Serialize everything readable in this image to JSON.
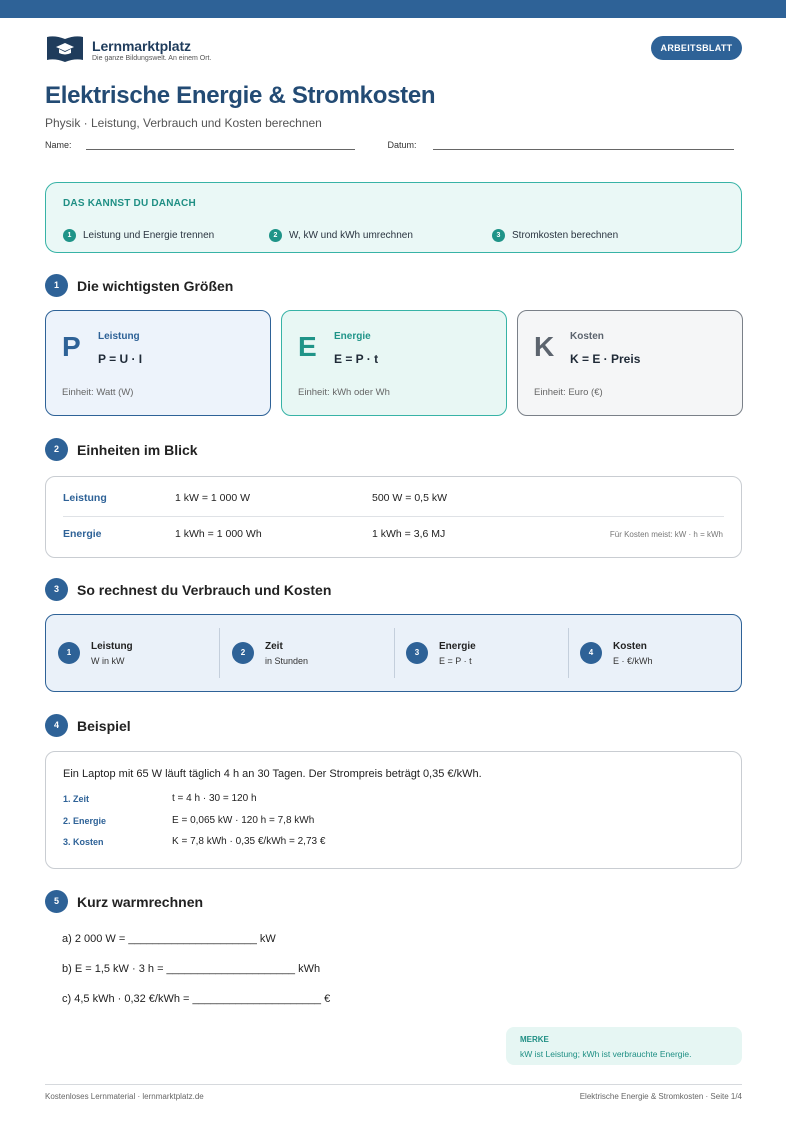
{
  "brand": {
    "name": "Lernmarktplatz",
    "tagline": "Die ganze Bildungswelt. An einem Ort.",
    "badge": "ARBEITSBLATT",
    "color": "#2e6297"
  },
  "header": {
    "title": "Elektrische Energie & Stromkosten",
    "subtitle": "Physik · Leistung, Verbrauch und Kosten berechnen",
    "name_label": "Name:",
    "date_label": "Datum:"
  },
  "goals": {
    "title": "DAS KANNST DU DANACH",
    "items": [
      {
        "num": "1",
        "text": "Leistung und Energie trennen"
      },
      {
        "num": "2",
        "text": "W, kW und kWh umrechnen"
      },
      {
        "num": "3",
        "text": "Stromkosten berechnen"
      }
    ]
  },
  "sections": [
    {
      "num": "1",
      "title": "Die wichtigsten Größen"
    },
    {
      "num": "2",
      "title": "Einheiten im Blick"
    },
    {
      "num": "3",
      "title": "So rechnest du Verbrauch und Kosten"
    },
    {
      "num": "4",
      "title": "Beispiel"
    },
    {
      "num": "5",
      "title": "Kurz warmrechnen"
    }
  ],
  "quantities": [
    {
      "letter": "P",
      "name": "Leistung",
      "formula": "P = U · I",
      "unit": "Einheit: Watt (W)"
    },
    {
      "letter": "E",
      "name": "Energie",
      "formula": "E = P · t",
      "unit": "Einheit: kWh oder Wh"
    },
    {
      "letter": "K",
      "name": "Kosten",
      "formula": "K = E · Preis",
      "unit": "Einheit: Euro (€)"
    }
  ],
  "units": {
    "rows": [
      {
        "label": "Leistung",
        "a": "1 kW = 1 000 W",
        "b": "500 W = 0,5 kW",
        "note": ""
      },
      {
        "label": "Energie",
        "a": "1 kWh = 1 000 Wh",
        "b": "1 kWh = 3,6 MJ",
        "note": "Für Kosten meist: kW · h = kWh"
      }
    ]
  },
  "steps": [
    {
      "num": "1",
      "title": "Leistung",
      "sub": "W in kW"
    },
    {
      "num": "2",
      "title": "Zeit",
      "sub": "in Stunden"
    },
    {
      "num": "3",
      "title": "Energie",
      "sub": "E = P · t"
    },
    {
      "num": "4",
      "title": "Kosten",
      "sub": "E · €/kWh"
    }
  ],
  "example": {
    "text": "Ein Laptop mit 65 W läuft täglich 4 h an 30 Tagen. Der Strompreis beträgt 0,35 €/kWh.",
    "lines": [
      {
        "label": "1. Zeit",
        "value": "t = 4 h · 30 = 120 h"
      },
      {
        "label": "2. Energie",
        "value": "E = 0,065 kW · 120 h = 7,8 kWh"
      },
      {
        "label": "3. Kosten",
        "value": "K = 7,8 kWh · 0,35 €/kWh = 2,73 €"
      }
    ]
  },
  "tasks": [
    {
      "prefix": "a) 2 000 W = ",
      "blank": "_____________________",
      "suffix": " kW"
    },
    {
      "prefix": "b) E = 1,5 kW · 3 h = ",
      "blank": "_____________________",
      "suffix": " kWh"
    },
    {
      "prefix": "c) 4,5 kWh · 0,32 €/kWh = ",
      "blank": "_____________________",
      "suffix": " €"
    }
  ],
  "merke": {
    "title": "MERKE",
    "text": "kW ist Leistung; kWh ist verbrauchte Energie."
  },
  "footer": {
    "left": "Kostenloses Lernmaterial · lernmarktplatz.de",
    "right": "Elektrische Energie & Stromkosten · Seite 1/4"
  }
}
